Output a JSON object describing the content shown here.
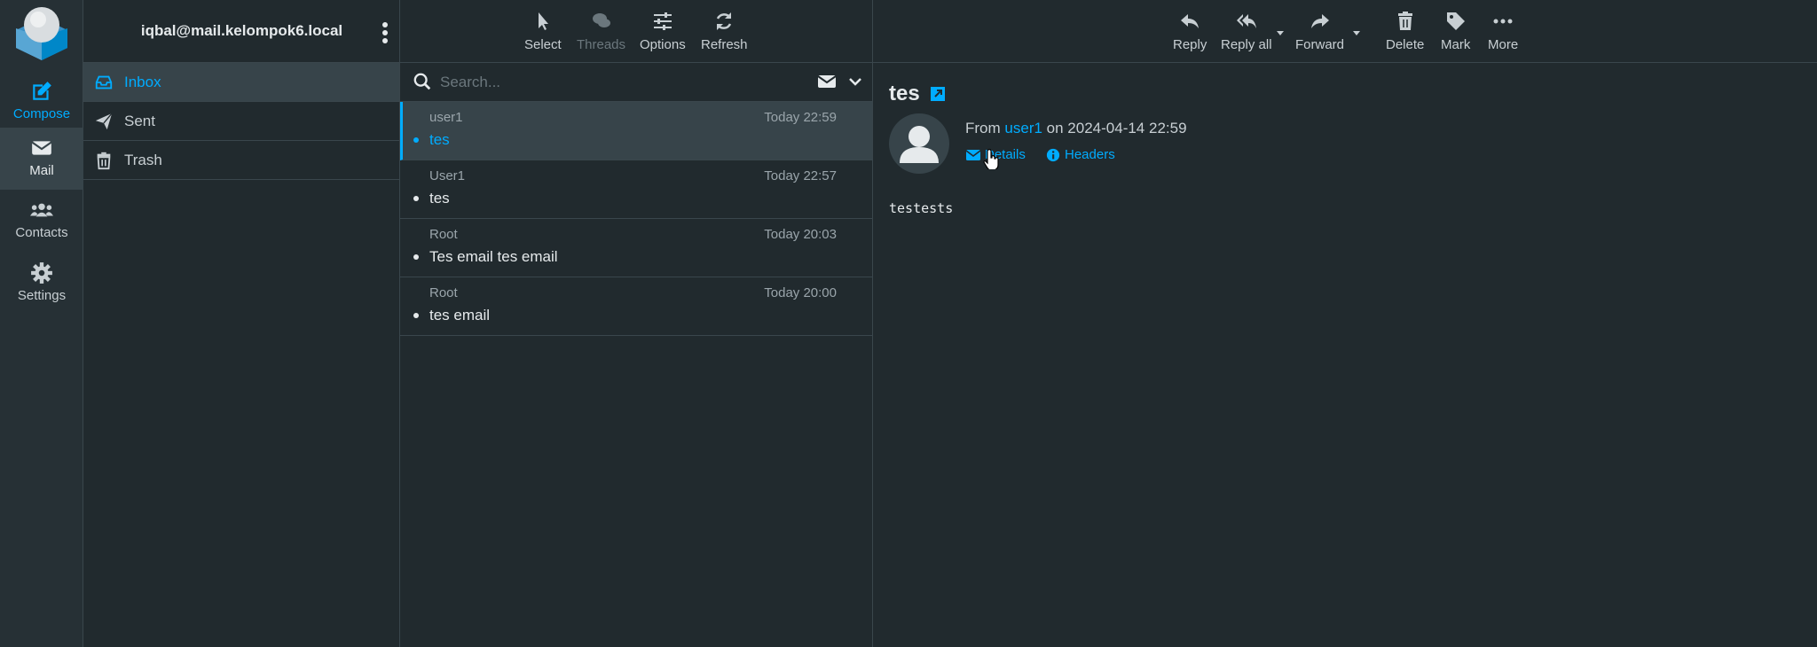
{
  "rail": {
    "compose": "Compose",
    "mail": "Mail",
    "contacts": "Contacts",
    "settings": "Settings"
  },
  "folders": {
    "account": "iqbal@mail.kelompok6.local",
    "items": [
      {
        "name": "Inbox",
        "icon": "inbox-icon",
        "active": true
      },
      {
        "name": "Sent",
        "icon": "paper-plane-icon"
      },
      {
        "name": "Trash",
        "icon": "trash-icon"
      }
    ]
  },
  "list_toolbar": {
    "select": "Select",
    "threads": "Threads",
    "options": "Options",
    "refresh": "Refresh"
  },
  "search": {
    "placeholder": "Search..."
  },
  "messages": [
    {
      "from": "user1",
      "time": "Today 22:59",
      "subject": "tes",
      "selected": true
    },
    {
      "from": "User1",
      "time": "Today 22:57",
      "subject": "tes"
    },
    {
      "from": "Root",
      "time": "Today 20:03",
      "subject": "Tes email tes email"
    },
    {
      "from": "Root",
      "time": "Today 20:00",
      "subject": "tes email"
    }
  ],
  "reader_toolbar": {
    "reply": "Reply",
    "reply_all": "Reply all",
    "forward": "Forward",
    "delete": "Delete",
    "mark": "Mark",
    "more": "More"
  },
  "message": {
    "subject": "tes",
    "from_prefix": "From",
    "from_user": "user1",
    "date_text": "on 2024-04-14 22:59",
    "details_label": "Details",
    "headers_label": "Headers",
    "body": "testests"
  },
  "colors": {
    "accent": "#00acff",
    "background": "#212a2e",
    "panel_active": "#37444a"
  }
}
